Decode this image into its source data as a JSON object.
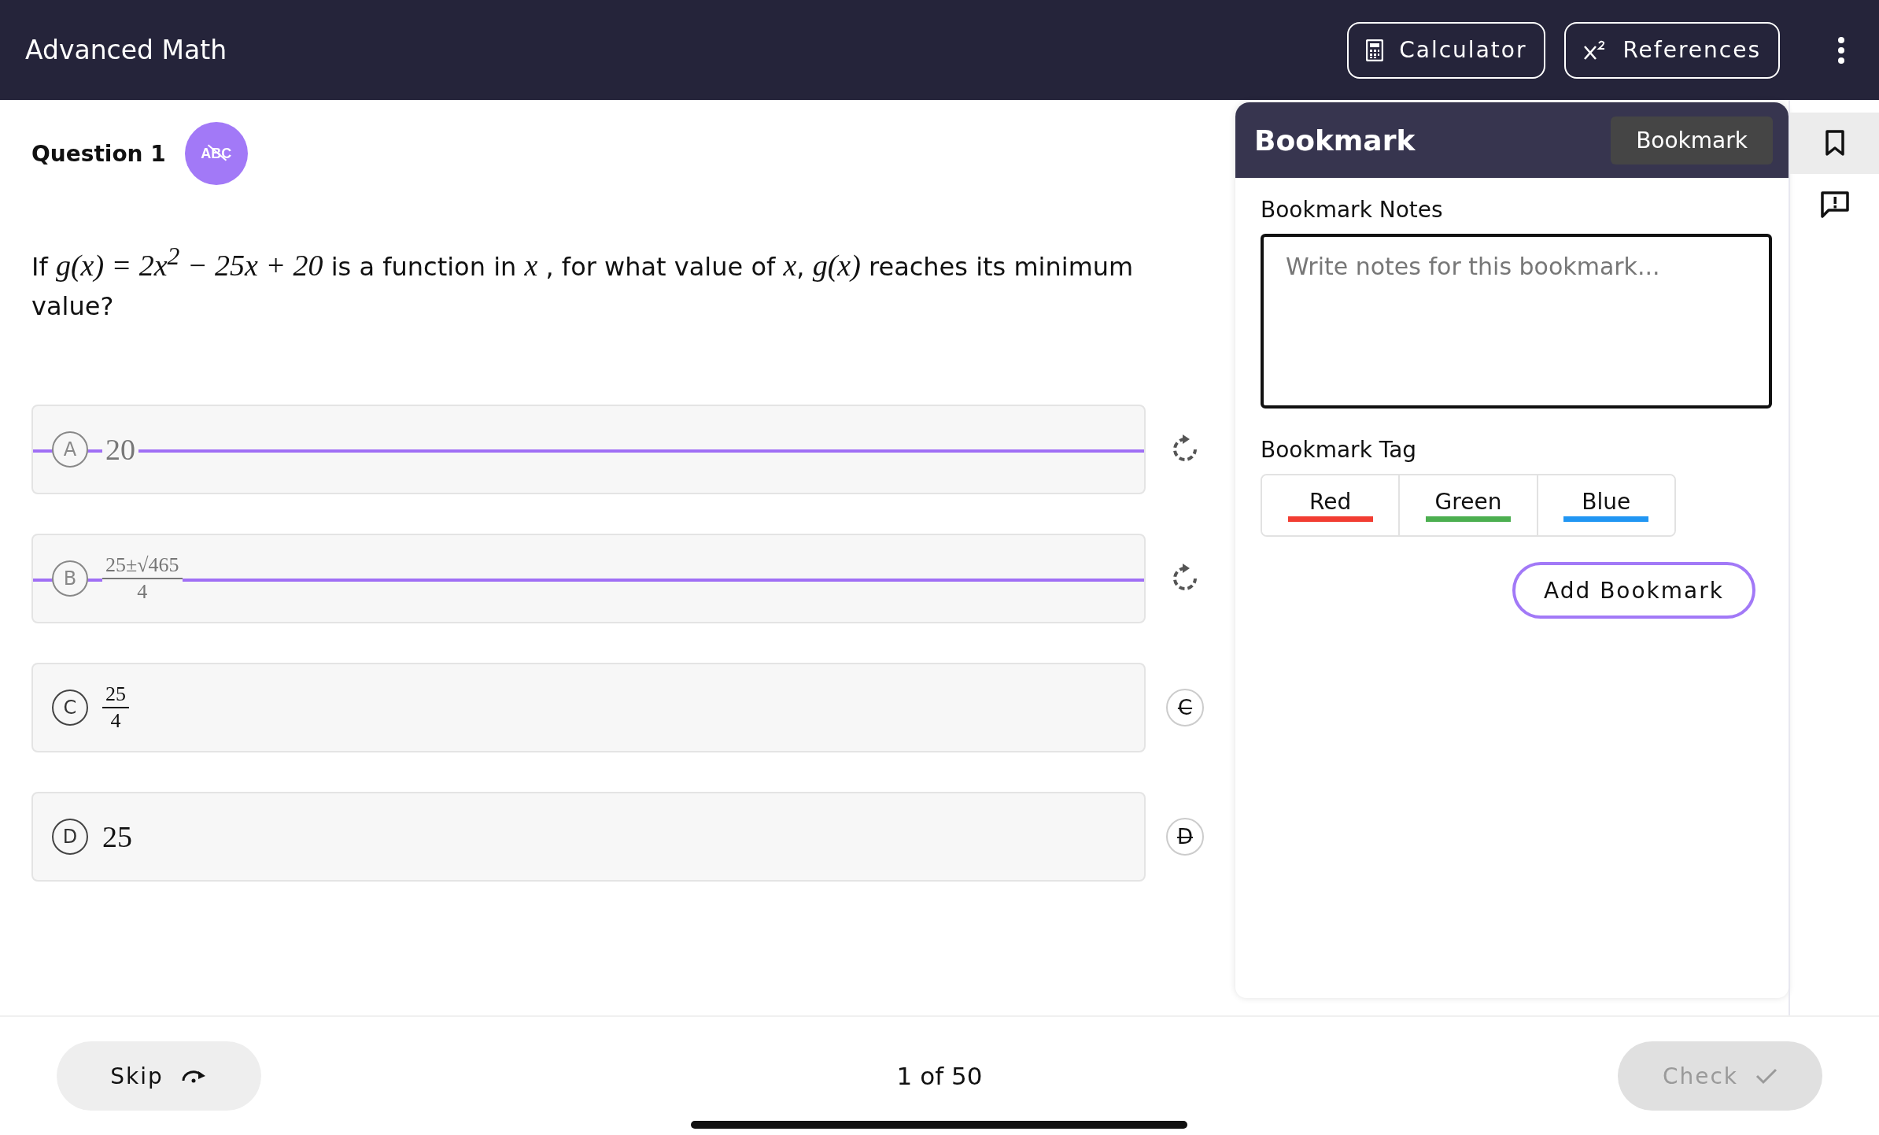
{
  "header": {
    "title": "Advanced Math",
    "buttons": [
      {
        "kind": "calculator",
        "label": "Calculator"
      },
      {
        "kind": "references",
        "label": "References"
      }
    ]
  },
  "question": {
    "label": "Question 1",
    "eliminator": {
      "label": "ABC",
      "on": true
    },
    "segments": [
      {
        "kind": "text",
        "text": "If "
      },
      {
        "kind": "math",
        "text": "g(x) = 2x$^{2}$ − 25x + 20"
      },
      {
        "kind": "text",
        "text": " is a function in "
      },
      {
        "kind": "math",
        "text": "x"
      },
      {
        "kind": "text",
        "text": " , for what value of "
      },
      {
        "kind": "math",
        "text": "x"
      },
      {
        "kind": "text",
        "text": ", "
      },
      {
        "kind": "math",
        "text": "g(x)"
      },
      {
        "kind": "text",
        "text": " reaches its minimum value?"
      }
    ]
  },
  "options": [
    {
      "letter": "A",
      "kind": "number",
      "value": "20",
      "eliminated": true
    },
    {
      "letter": "B",
      "kind": "fraction",
      "numerator": "25±√465",
      "denominator": "4",
      "eliminated": true
    },
    {
      "letter": "C",
      "kind": "fraction",
      "numerator": "25",
      "denominator": "4",
      "eliminated": false,
      "eliminate_label": "C"
    },
    {
      "letter": "D",
      "kind": "number",
      "value": "25",
      "eliminated": false,
      "eliminate_label": "D"
    }
  ],
  "bookmark_panel": {
    "title": "Bookmark",
    "tooltip": "Bookmark",
    "notes_label": "Bookmark Notes",
    "notes_placeholder": "Write notes for this bookmark...",
    "tag_label": "Bookmark Tag",
    "tags": [
      {
        "label": "Red",
        "color": "#f23d32"
      },
      {
        "label": "Green",
        "color": "#4caf50"
      },
      {
        "label": "Blue",
        "color": "#2196f3"
      }
    ],
    "add_button": "Add Bookmark"
  },
  "side_tools": [
    {
      "kind": "bookmark",
      "selected": true
    },
    {
      "kind": "report",
      "selected": false
    }
  ],
  "footer": {
    "skip": "Skip",
    "progress": "1 of 50",
    "check": {
      "label": "Check",
      "disabled": true
    }
  }
}
